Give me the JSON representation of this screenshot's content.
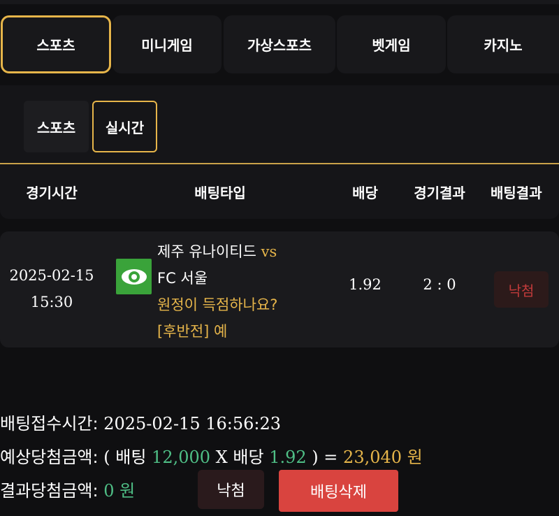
{
  "main_tabs": [
    {
      "label": "스포츠",
      "active": true
    },
    {
      "label": "미니게임",
      "active": false
    },
    {
      "label": "가상스포츠",
      "active": false
    },
    {
      "label": "벳게임",
      "active": false
    },
    {
      "label": "카지노",
      "active": false
    }
  ],
  "sub_tabs": [
    {
      "label": "스포츠",
      "active": false
    },
    {
      "label": "실시간",
      "active": true
    }
  ],
  "table": {
    "headers": [
      "경기시간",
      "배팅타입",
      "배당",
      "경기결과",
      "배팅결과"
    ]
  },
  "bet": {
    "date": "2025-02-15",
    "time": "15:30",
    "team_home": "제주 유나이티드",
    "vs": "vs",
    "team_away": "FC 서울",
    "question": "원정이 득점하나요?",
    "selection": "[후반전] 예",
    "icon": "eye-icon",
    "odds": "1.92",
    "score": "2 : 0",
    "result": "낙첨"
  },
  "summary": {
    "receipt_label": "배팅접수시간:",
    "receipt_time": "2025-02-15 16:56:23",
    "expected_label": "예상당첨금액:",
    "open_paren": "(",
    "bet_word": "배팅",
    "bet_amount": "12,000",
    "times": "X",
    "odds_word": "배당",
    "odds_value": "1.92",
    "close_eq": ") =",
    "expected_amount": "23,040",
    "won": "원",
    "result_label": "결과당첨금액:",
    "result_amount": "0",
    "result_won": "원"
  },
  "buttons": {
    "lose_label": "낙첨",
    "delete_label": "배팅삭제"
  },
  "colors": {
    "accent_gold": "#e6b54a",
    "green": "#4fbf86",
    "danger": "#d9443f",
    "lose_text": "#c03a3a"
  }
}
